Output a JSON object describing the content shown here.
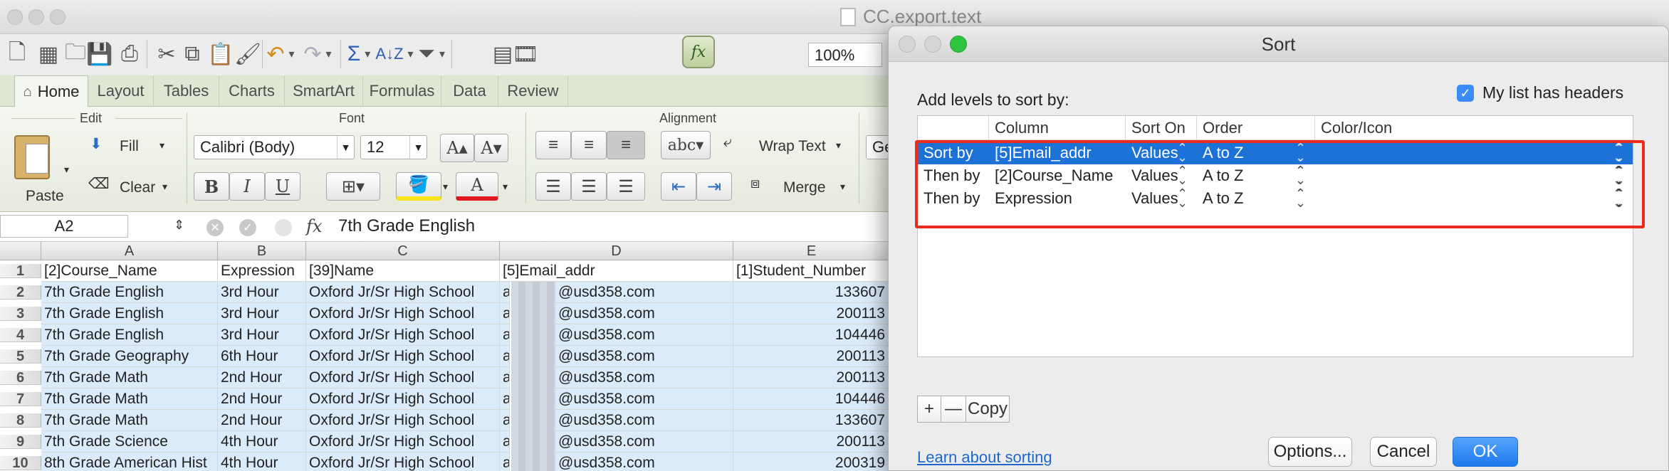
{
  "window": {
    "doc_title": "CC.export.text"
  },
  "toolbar": {
    "zoom": "100%"
  },
  "ribbon": {
    "tabs": [
      "Home",
      "Layout",
      "Tables",
      "Charts",
      "SmartArt",
      "Formulas",
      "Data",
      "Review"
    ],
    "groups": {
      "edit": "Edit",
      "font": "Font",
      "alignment": "Alignment"
    },
    "paste_label": "Paste",
    "fill_label": "Fill",
    "clear_label": "Clear",
    "font_name": "Calibri (Body)",
    "font_size": "12",
    "wrap_text_label": "Wrap Text",
    "merge_label": "Merge",
    "abc_label": "abc",
    "cut_off_label": "Ge"
  },
  "formula_bar": {
    "name_box": "A2",
    "fx": "fx",
    "value": "7th Grade English"
  },
  "sheet": {
    "columns": [
      "A",
      "B",
      "C",
      "D",
      "E"
    ],
    "rows": [
      {
        "num": "1",
        "cells": [
          "[2]Course_Name",
          "Expression",
          "[39]Name",
          "[5]Email_addr",
          "[1]Student_Number"
        ]
      },
      {
        "num": "2",
        "cells": [
          "7th Grade English",
          "3rd Hour",
          "Oxford Jr/Sr High School",
          "a",
          "@usd358.com",
          "133607"
        ]
      },
      {
        "num": "3",
        "cells": [
          "7th Grade English",
          "3rd Hour",
          "Oxford Jr/Sr High School",
          "a",
          "@usd358.com",
          "200113"
        ]
      },
      {
        "num": "4",
        "cells": [
          "7th Grade English",
          "3rd Hour",
          "Oxford Jr/Sr High School",
          "a",
          "@usd358.com",
          "104446"
        ]
      },
      {
        "num": "5",
        "cells": [
          "7th Grade Geography",
          "6th Hour",
          "Oxford Jr/Sr High School",
          "a",
          "@usd358.com",
          "200113"
        ]
      },
      {
        "num": "6",
        "cells": [
          "7th Grade Math",
          "2nd Hour",
          "Oxford Jr/Sr High School",
          "a",
          "@usd358.com",
          "200113"
        ]
      },
      {
        "num": "7",
        "cells": [
          "7th Grade Math",
          "2nd Hour",
          "Oxford Jr/Sr High School",
          "a",
          "@usd358.com",
          "104446"
        ]
      },
      {
        "num": "8",
        "cells": [
          "7th Grade Math",
          "2nd Hour",
          "Oxford Jr/Sr High School",
          "a",
          "@usd358.com",
          "133607"
        ]
      },
      {
        "num": "9",
        "cells": [
          "7th Grade Science",
          "4th Hour",
          "Oxford Jr/Sr High School",
          "a",
          "@usd358.com",
          "200113"
        ]
      },
      {
        "num": "10",
        "cells": [
          "8th Grade American Hist",
          "4th Hour",
          "Oxford Jr/Sr High School",
          "a",
          "@usd358.com",
          "200319"
        ]
      }
    ]
  },
  "dialog": {
    "title": "Sort",
    "instruction": "Add levels to sort by:",
    "headers_checkbox": "My list has headers",
    "table_headers": [
      "Column",
      "Sort On",
      "Order",
      "Color/Icon"
    ],
    "levels": [
      {
        "label": "Sort by",
        "column": "[5]Email_addr",
        "sort_on": "Values",
        "order": "A to Z"
      },
      {
        "label": "Then by",
        "column": "[2]Course_Name",
        "sort_on": "Values",
        "order": "A to Z"
      },
      {
        "label": "Then by",
        "column": "Expression",
        "sort_on": "Values",
        "order": "A to Z"
      }
    ],
    "add_label": "+",
    "remove_label": "—",
    "copy_label": "Copy",
    "learn_link": "Learn about sorting",
    "options_button": "Options...",
    "cancel_button": "Cancel",
    "ok_button": "OK"
  },
  "colors": {
    "selection_blue": "#1d72d8",
    "highlight_red": "#ee2a1c",
    "ribbon_green": "#dfe6d4"
  }
}
